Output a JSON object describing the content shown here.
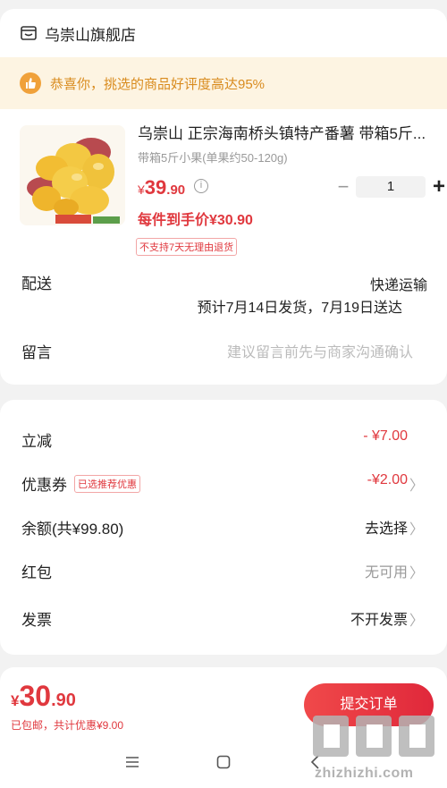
{
  "shop": {
    "name": "乌崇山旗舰店",
    "icon": "store-icon"
  },
  "banner": {
    "text": "恭喜你，挑选的商品好评度高达95%",
    "icon": "thumbs-up-icon"
  },
  "product": {
    "title": "乌崇山 正宗海南桥头镇特产番薯 带箱5斤...",
    "spec": "带箱5斤小果(单果约50-120g)",
    "price_currency": "¥",
    "price_int": "39",
    "price_dec": ".90",
    "quantity": "1",
    "final_price": "每件到手价¥30.90",
    "tag": "不支持7天无理由退货"
  },
  "delivery": {
    "label": "配送",
    "method": "快递运输",
    "estimate": "预计7月14日发货，7月19日送达"
  },
  "message": {
    "label": "留言",
    "placeholder": "建议留言前先与商家沟通确认"
  },
  "discounts": [
    {
      "label": "立减",
      "value": "- ¥7.00"
    },
    {
      "label": "优惠券",
      "badge": "已选推荐优惠",
      "value": "-¥2.00"
    },
    {
      "label": "余额(共¥99.80)",
      "value": "去选择"
    },
    {
      "label": "红包",
      "value": "无可用"
    },
    {
      "label": "发票",
      "value": "不开发票"
    }
  ],
  "bottom": {
    "currency": "¥",
    "total_int": "30",
    "total_dec": ".90",
    "summary": "已包邮，共计优惠¥9.00",
    "submit_label": "提交订单"
  },
  "watermark": {
    "text": "zhizhizhi.com",
    "glyphs": "值值值"
  },
  "colors": {
    "accent": "#e0383e",
    "banner_bg": "#fdf4e2",
    "banner_text": "#d98b1e"
  }
}
